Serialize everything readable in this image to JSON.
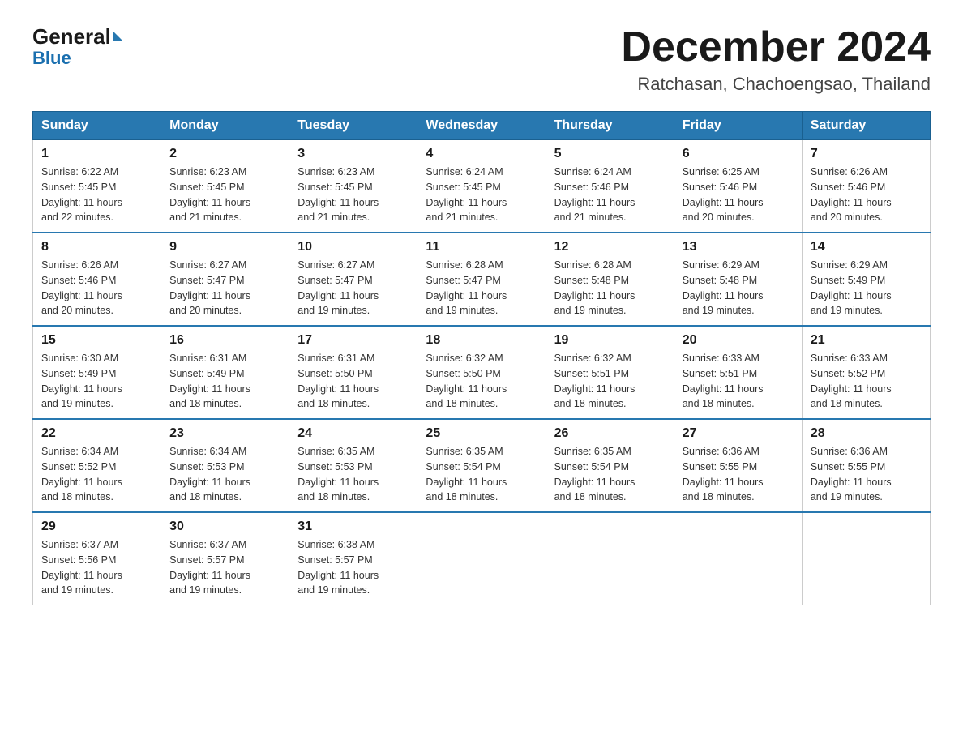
{
  "header": {
    "logo": {
      "general": "General",
      "blue": "Blue",
      "subtitle": "Blue"
    },
    "title": "December 2024",
    "location": "Ratchasan, Chachoengsao, Thailand"
  },
  "calendar": {
    "days_of_week": [
      "Sunday",
      "Monday",
      "Tuesday",
      "Wednesday",
      "Thursday",
      "Friday",
      "Saturday"
    ],
    "weeks": [
      [
        {
          "day": "1",
          "sunrise": "6:22 AM",
          "sunset": "5:45 PM",
          "daylight": "11 hours and 22 minutes."
        },
        {
          "day": "2",
          "sunrise": "6:23 AM",
          "sunset": "5:45 PM",
          "daylight": "11 hours and 21 minutes."
        },
        {
          "day": "3",
          "sunrise": "6:23 AM",
          "sunset": "5:45 PM",
          "daylight": "11 hours and 21 minutes."
        },
        {
          "day": "4",
          "sunrise": "6:24 AM",
          "sunset": "5:45 PM",
          "daylight": "11 hours and 21 minutes."
        },
        {
          "day": "5",
          "sunrise": "6:24 AM",
          "sunset": "5:46 PM",
          "daylight": "11 hours and 21 minutes."
        },
        {
          "day": "6",
          "sunrise": "6:25 AM",
          "sunset": "5:46 PM",
          "daylight": "11 hours and 20 minutes."
        },
        {
          "day": "7",
          "sunrise": "6:26 AM",
          "sunset": "5:46 PM",
          "daylight": "11 hours and 20 minutes."
        }
      ],
      [
        {
          "day": "8",
          "sunrise": "6:26 AM",
          "sunset": "5:46 PM",
          "daylight": "11 hours and 20 minutes."
        },
        {
          "day": "9",
          "sunrise": "6:27 AM",
          "sunset": "5:47 PM",
          "daylight": "11 hours and 20 minutes."
        },
        {
          "day": "10",
          "sunrise": "6:27 AM",
          "sunset": "5:47 PM",
          "daylight": "11 hours and 19 minutes."
        },
        {
          "day": "11",
          "sunrise": "6:28 AM",
          "sunset": "5:47 PM",
          "daylight": "11 hours and 19 minutes."
        },
        {
          "day": "12",
          "sunrise": "6:28 AM",
          "sunset": "5:48 PM",
          "daylight": "11 hours and 19 minutes."
        },
        {
          "day": "13",
          "sunrise": "6:29 AM",
          "sunset": "5:48 PM",
          "daylight": "11 hours and 19 minutes."
        },
        {
          "day": "14",
          "sunrise": "6:29 AM",
          "sunset": "5:49 PM",
          "daylight": "11 hours and 19 minutes."
        }
      ],
      [
        {
          "day": "15",
          "sunrise": "6:30 AM",
          "sunset": "5:49 PM",
          "daylight": "11 hours and 19 minutes."
        },
        {
          "day": "16",
          "sunrise": "6:31 AM",
          "sunset": "5:49 PM",
          "daylight": "11 hours and 18 minutes."
        },
        {
          "day": "17",
          "sunrise": "6:31 AM",
          "sunset": "5:50 PM",
          "daylight": "11 hours and 18 minutes."
        },
        {
          "day": "18",
          "sunrise": "6:32 AM",
          "sunset": "5:50 PM",
          "daylight": "11 hours and 18 minutes."
        },
        {
          "day": "19",
          "sunrise": "6:32 AM",
          "sunset": "5:51 PM",
          "daylight": "11 hours and 18 minutes."
        },
        {
          "day": "20",
          "sunrise": "6:33 AM",
          "sunset": "5:51 PM",
          "daylight": "11 hours and 18 minutes."
        },
        {
          "day": "21",
          "sunrise": "6:33 AM",
          "sunset": "5:52 PM",
          "daylight": "11 hours and 18 minutes."
        }
      ],
      [
        {
          "day": "22",
          "sunrise": "6:34 AM",
          "sunset": "5:52 PM",
          "daylight": "11 hours and 18 minutes."
        },
        {
          "day": "23",
          "sunrise": "6:34 AM",
          "sunset": "5:53 PM",
          "daylight": "11 hours and 18 minutes."
        },
        {
          "day": "24",
          "sunrise": "6:35 AM",
          "sunset": "5:53 PM",
          "daylight": "11 hours and 18 minutes."
        },
        {
          "day": "25",
          "sunrise": "6:35 AM",
          "sunset": "5:54 PM",
          "daylight": "11 hours and 18 minutes."
        },
        {
          "day": "26",
          "sunrise": "6:35 AM",
          "sunset": "5:54 PM",
          "daylight": "11 hours and 18 minutes."
        },
        {
          "day": "27",
          "sunrise": "6:36 AM",
          "sunset": "5:55 PM",
          "daylight": "11 hours and 18 minutes."
        },
        {
          "day": "28",
          "sunrise": "6:36 AM",
          "sunset": "5:55 PM",
          "daylight": "11 hours and 19 minutes."
        }
      ],
      [
        {
          "day": "29",
          "sunrise": "6:37 AM",
          "sunset": "5:56 PM",
          "daylight": "11 hours and 19 minutes."
        },
        {
          "day": "30",
          "sunrise": "6:37 AM",
          "sunset": "5:57 PM",
          "daylight": "11 hours and 19 minutes."
        },
        {
          "day": "31",
          "sunrise": "6:38 AM",
          "sunset": "5:57 PM",
          "daylight": "11 hours and 19 minutes."
        },
        null,
        null,
        null,
        null
      ]
    ],
    "labels": {
      "sunrise": "Sunrise:",
      "sunset": "Sunset:",
      "daylight": "Daylight:"
    }
  }
}
